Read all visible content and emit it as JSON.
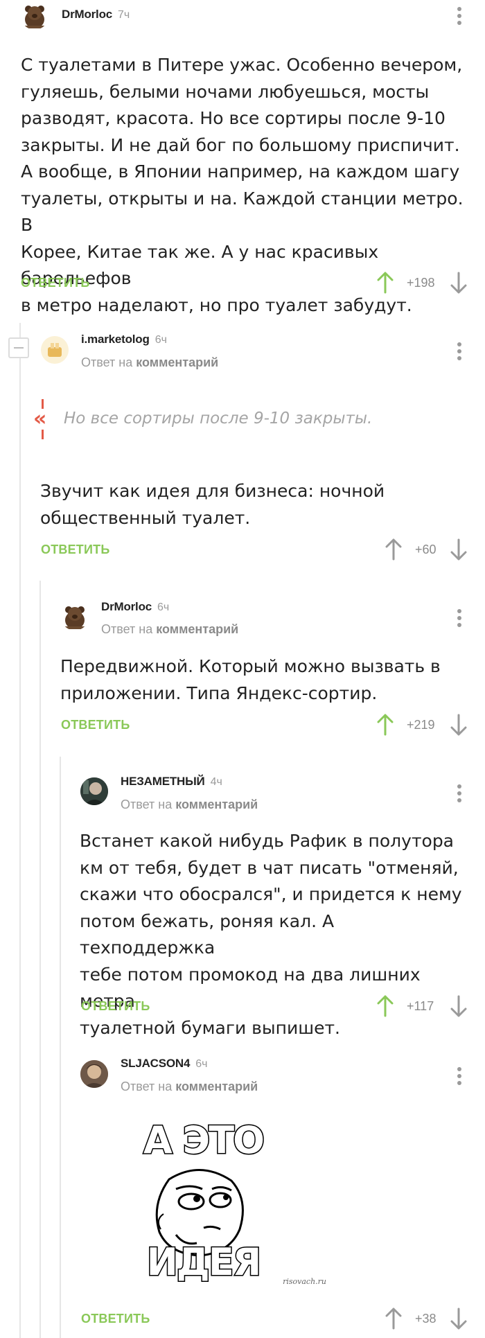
{
  "comments": [
    {
      "username": "DrMorloc",
      "time": "7ч",
      "lines": [
        "С туалетами в Питере ужас. Особенно вечером,",
        "гуляешь, белыми ночами любуешься, мосты",
        "разводят, красота. Но все сортиры после 9-10",
        "закрыты. И не дай бог по большому приспичит.",
        "А вообще, в Японии например, на каждом шагу",
        "туалеты, открыты и на. Каждой станции метро. В",
        "Корее, Китае так же. А у нас красивых барельефов",
        "в метро наделают, но про туалет забудут."
      ],
      "reply_label": "ОТВЕТИТЬ",
      "score": "+198"
    },
    {
      "username": "i.marketolog",
      "time": "6ч",
      "reply_to_prefix": "Ответ на",
      "reply_to_link": "комментарий",
      "quote": "Но все сортиры после 9-10 закрыты.",
      "lines": [
        "Звучит как идея для бизнеса: ночной",
        "общественный туалет."
      ],
      "reply_label": "ОТВЕТИТЬ",
      "score": "+60"
    },
    {
      "username": "DrMorloc",
      "time": "6ч",
      "reply_to_prefix": "Ответ на",
      "reply_to_link": "комментарий",
      "lines": [
        "Передвижной. Который можно вызвать в",
        "приложении. Типа Яндекс-сортир."
      ],
      "reply_label": "ОТВЕТИТЬ",
      "score": "+219"
    },
    {
      "username": "НЕЗАМЕТНЫЙ",
      "time": "4ч",
      "reply_to_prefix": "Ответ на",
      "reply_to_link": "комментарий",
      "lines": [
        "Встанет какой нибудь Рафик в полутора",
        "км от тебя, будет в чат писать \"отменяй,",
        "скажи что обосрался\", и придется к нему",
        "потом бежать, роняя кал. А техподдержка",
        "тебе потом промокод на два лишних метра",
        "туалетной бумаги выпишет."
      ],
      "reply_label": "ОТВЕТИТЬ",
      "score": "+117"
    },
    {
      "username": "SLJACSON4",
      "time": "6ч",
      "reply_to_prefix": "Ответ на",
      "reply_to_link": "комментарий",
      "meme": {
        "top_text": "А ЭТО",
        "bottom_text": "ИДЕЯ",
        "watermark": "risovach.ru"
      },
      "reply_label": "ОТВЕТИТЬ",
      "score": "+38"
    }
  ],
  "colors": {
    "accent_green": "#8ac858",
    "muted": "#9a9a9a",
    "quote_mark": "#e35a47"
  },
  "icons": [
    "kebab-menu-icon",
    "upvote-arrow-icon",
    "downvote-arrow-icon",
    "collapse-thread-icon",
    "quote-mark-icon"
  ]
}
